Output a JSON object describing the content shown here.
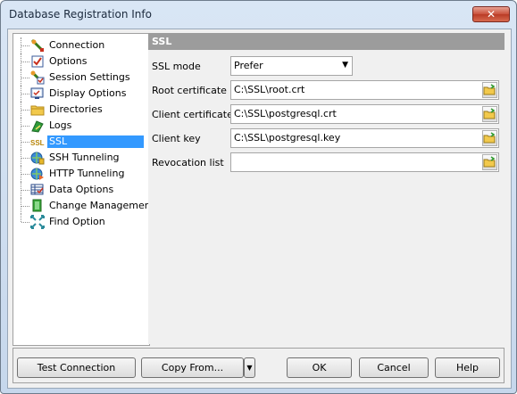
{
  "window": {
    "title": "Database Registration Info"
  },
  "tree": {
    "items": [
      {
        "label": "Connection",
        "icon": "connection-icon"
      },
      {
        "label": "Options",
        "icon": "options-icon"
      },
      {
        "label": "Session Settings",
        "icon": "session-settings-icon"
      },
      {
        "label": "Display Options",
        "icon": "display-options-icon"
      },
      {
        "label": "Directories",
        "icon": "folder-icon"
      },
      {
        "label": "Logs",
        "icon": "logs-icon"
      },
      {
        "label": "SSL",
        "icon": "ssl-icon",
        "selected": true
      },
      {
        "label": "SSH Tunneling",
        "icon": "ssh-tunneling-icon"
      },
      {
        "label": "HTTP Tunneling",
        "icon": "http-tunneling-icon"
      },
      {
        "label": "Data Options",
        "icon": "data-options-icon"
      },
      {
        "label": "Change Management",
        "icon": "change-management-icon"
      },
      {
        "label": "Find Option",
        "icon": "find-option-icon"
      }
    ]
  },
  "panel": {
    "header": "SSL",
    "ssl_mode": {
      "label": "SSL mode",
      "value": "Prefer"
    },
    "root_certificate": {
      "label": "Root certificate",
      "value": "C:\\SSL\\root.crt"
    },
    "client_certificate": {
      "label": "Client certificate",
      "value": "C:\\SSL\\postgresql.crt"
    },
    "client_key": {
      "label": "Client key",
      "value": "C:\\SSL\\postgresql.key"
    },
    "revocation_list": {
      "label": "Revocation list",
      "value": ""
    }
  },
  "buttons": {
    "test_connection": "Test Connection",
    "copy_from": "Copy From...",
    "ok": "OK",
    "cancel": "Cancel",
    "help": "Help"
  },
  "colors": {
    "selection": "#3399ff",
    "panel_header": "#9c9c9c"
  }
}
